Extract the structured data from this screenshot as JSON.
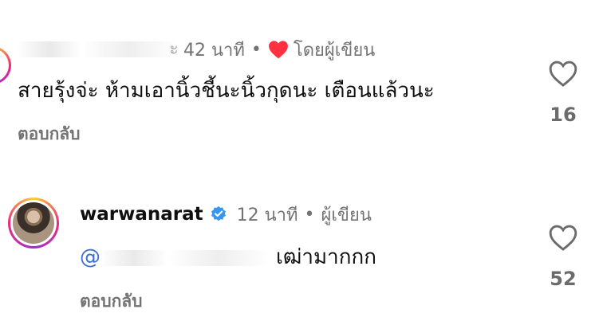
{
  "comments": [
    {
      "username_visible_suffix": "ะ",
      "time": "42 นาที",
      "separator": "•",
      "liked_by_author_label": "โดยผู้เขียน",
      "text": "สายรุ้งจ่ะ ห้ามเอานิ้วชี้นะนิ้วกุดนะ เตือนแล้วนะ",
      "reply_label": "ตอบกลับ",
      "like_count": "16"
    },
    {
      "username": "warwanarat",
      "time": "12 นาที",
      "separator": "•",
      "author_label": "ผู้เขียน",
      "mention_prefix": "@",
      "text": "เฒ่ามากกก",
      "reply_label": "ตอบกลับ",
      "like_count": "52"
    }
  ],
  "colors": {
    "heart_red": "#ff3040",
    "verified_blue": "#3797f0",
    "mention_blue": "#3c6fd6",
    "secondary_text": "#737373"
  },
  "icons": {
    "liked_by_author": "red-heart-icon",
    "verified": "verified-badge-icon",
    "like": "heart-outline-icon"
  }
}
